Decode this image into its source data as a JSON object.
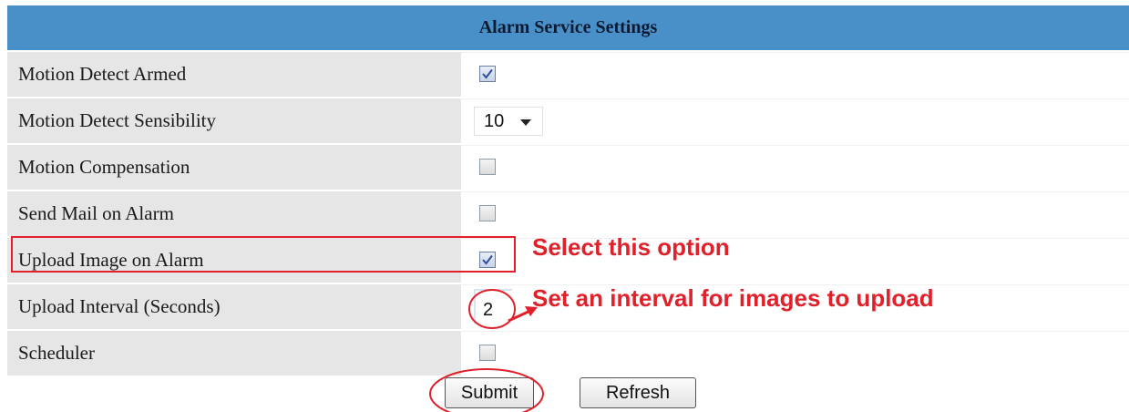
{
  "panel": {
    "title": "Alarm Service Settings"
  },
  "settings": [
    {
      "label": "Motion Detect Armed",
      "control": "checkbox",
      "checked": true
    },
    {
      "label": "Motion Detect Sensibility",
      "control": "select",
      "value": "10"
    },
    {
      "label": "Motion Compensation",
      "control": "checkbox",
      "checked": false
    },
    {
      "label": "Send Mail on Alarm",
      "control": "checkbox",
      "checked": false
    },
    {
      "label": "Upload Image on Alarm",
      "control": "checkbox",
      "checked": true
    },
    {
      "label": "Upload Interval (Seconds)",
      "control": "text",
      "value": "2"
    },
    {
      "label": "Scheduler",
      "control": "checkbox",
      "checked": false
    }
  ],
  "buttons": {
    "submit": "Submit",
    "refresh": "Refresh"
  },
  "annotations": {
    "select_option": "Select this option",
    "set_interval": "Set an interval for images to upload",
    "color": "#e0202a"
  },
  "colors": {
    "header_bg": "#4a90c8",
    "label_bg": "#e6e6e6"
  }
}
